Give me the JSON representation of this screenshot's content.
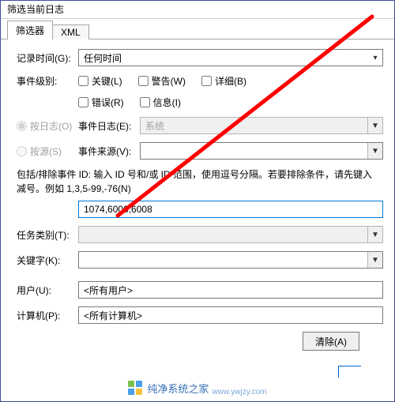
{
  "window": {
    "title": "筛选当前日志"
  },
  "tabs": {
    "filter": "筛选器",
    "xml": "XML"
  },
  "logged": {
    "label": "记录时间(G):",
    "value": "任何时间"
  },
  "level": {
    "label": "事件级别:",
    "critical": "关键(L)",
    "warning": "警告(W)",
    "verbose": "详细(B)",
    "error": "错误(R)",
    "info": "信息(I)"
  },
  "radios": {
    "bylog": "按日志(O)",
    "bysource": "按源(S)"
  },
  "eventlog": {
    "label": "事件日志(E):",
    "value": "系统"
  },
  "eventsource": {
    "label": "事件来源(V):",
    "value": ""
  },
  "idnote": {
    "line1": "包括/排除事件 ID: 输入 ID 号和/或 ID 范围，使用逗号分隔。若要排除条件，请先键入",
    "line2": "减号。例如 1,3,5-99,-76(N)"
  },
  "idfield": {
    "value": "1074,6006,6008"
  },
  "task": {
    "label": "任务类别(T):"
  },
  "keyword": {
    "label": "关键字(K):"
  },
  "user": {
    "label": "用户(U):",
    "value": "<所有用户>"
  },
  "computer": {
    "label": "计算机(P):",
    "value": "<所有计算机>"
  },
  "buttons": {
    "clear": "清除(A)"
  },
  "watermark": {
    "main": "纯净系统之家",
    "sub": "www.ywjzy.com"
  }
}
